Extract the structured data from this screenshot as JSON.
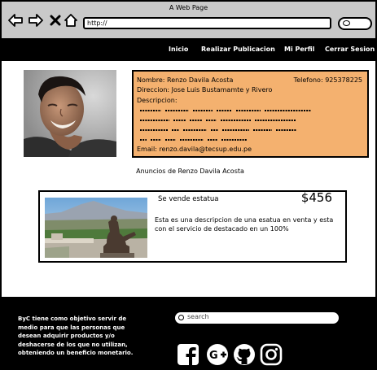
{
  "window": {
    "title": "A Web Page"
  },
  "browser": {
    "url": "http://",
    "icons": [
      "back-arrow-icon",
      "forward-arrow-icon",
      "close-icon",
      "home-icon",
      "search-icon"
    ]
  },
  "nav": {
    "items": [
      {
        "label": "Inicio"
      },
      {
        "label": "Realizar Publicacion"
      },
      {
        "label": "Mi Perfil"
      },
      {
        "label": "Cerrar Sesion"
      }
    ]
  },
  "profile": {
    "name_label": "Nombre:",
    "name": "Renzo Davila Acosta",
    "phone_label": "Telefono:",
    "phone": "925378225",
    "address_label": "Direccion:",
    "address": "Jose Luis Bustamamte y Rivero",
    "description_label": "Descripcion:",
    "email_label": "Email:",
    "email": "renzo.davila@tecsup.edu.pe",
    "card_color": "#f4b16f"
  },
  "ads": {
    "heading": "Anuncios de Renzo Davila Acosta",
    "items": [
      {
        "title": "Se vende estatua",
        "price": "$456",
        "description": "Esta es una descripcion de una esatua en venta y esta con el servicio de destacado en un 100%"
      }
    ]
  },
  "footer": {
    "text": "ByC tiene como objetivo servir de medio para que las personas que desean adquirir productos y/o deshacerse de los que no utilizan, obteniendo un beneficio monetario.",
    "search_placeholder": "search",
    "social_icons": [
      "facebook-icon",
      "google-plus-icon",
      "github-icon",
      "instagram-icon"
    ]
  }
}
